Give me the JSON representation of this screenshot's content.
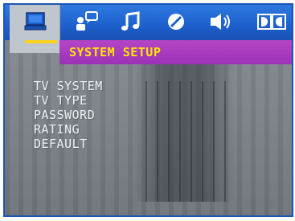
{
  "tabs": [
    {
      "name": "system-setup",
      "icon": "monitor-icon",
      "active": true
    },
    {
      "name": "language-setup",
      "icon": "person-speech-icon",
      "active": false
    },
    {
      "name": "audio-setup",
      "icon": "music-note-icon",
      "active": false
    },
    {
      "name": "video-setup",
      "icon": "circle-icon",
      "active": false
    },
    {
      "name": "speaker-setup",
      "icon": "speaker-icon",
      "active": false
    },
    {
      "name": "digital-setup",
      "icon": "dolby-digital-icon",
      "active": false
    }
  ],
  "header": {
    "title": "SYSTEM SETUP"
  },
  "menu": {
    "items": [
      "TV SYSTEM",
      "TV TYPE",
      "PASSWORD",
      "RATING",
      "DEFAULT"
    ]
  },
  "colors": {
    "topbar": "#2f79e0",
    "title_bar": "#b645c6",
    "title_text": "#ffe800",
    "active_tab": "#bfc6cd",
    "underline": "#ffd21a",
    "border": "#1c56b4"
  }
}
